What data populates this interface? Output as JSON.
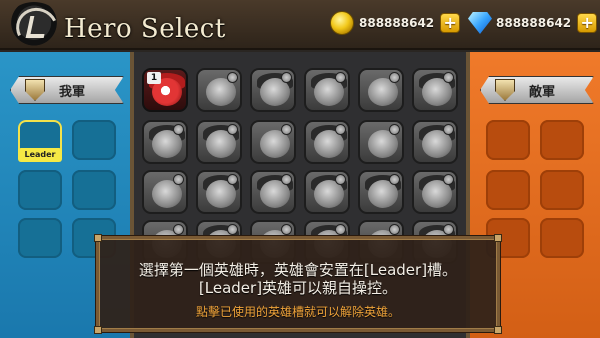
{
  "header": {
    "title": "Hero Select",
    "gold": "888888642",
    "gems": "888888642",
    "plus_label": "+"
  },
  "left_panel": {
    "label": "我軍",
    "leader_tag": "Leader",
    "color": "#2a95c7"
  },
  "right_panel": {
    "label": "敵軍",
    "color": "#f07a2a"
  },
  "hero_grid": {
    "selected_badge": "1",
    "columns": 6,
    "rows": 4
  },
  "dialog": {
    "line1": "選擇第一個英雄時，英雄會安置在[Leader]槽。",
    "line2": "[Leader]英雄可以親自操控。",
    "line3": "點擊已使用的英雄槽就可以解除英雄。",
    "hint_color": "#f0a43a"
  }
}
